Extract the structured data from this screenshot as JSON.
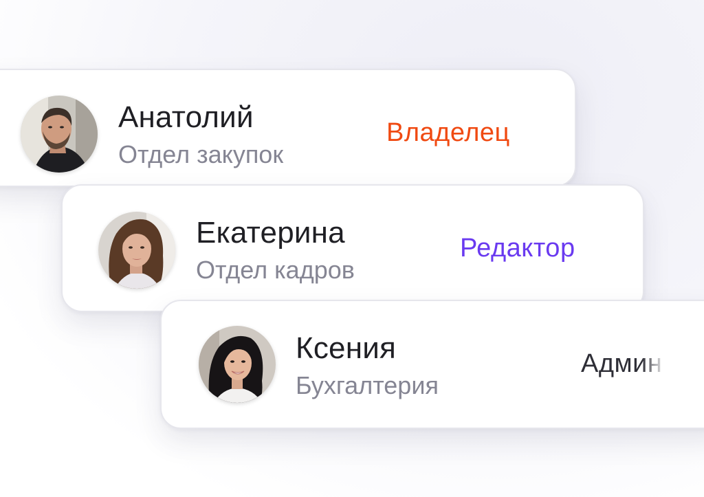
{
  "users": [
    {
      "name": "Анатолий",
      "department": "Отдел закупок",
      "role": "Владелец",
      "role_color": "#f04a12",
      "avatar": "man-avatar-photo"
    },
    {
      "name": "Екатерина",
      "department": "Отдел кадров",
      "role": "Редактор",
      "role_color": "#6a3af0",
      "avatar": "woman-avatar-photo"
    },
    {
      "name": "Ксения",
      "department": "Бухгалтерия",
      "role": "Админ",
      "role_color": "#2e2e36",
      "avatar": "woman-avatar-photo"
    }
  ]
}
